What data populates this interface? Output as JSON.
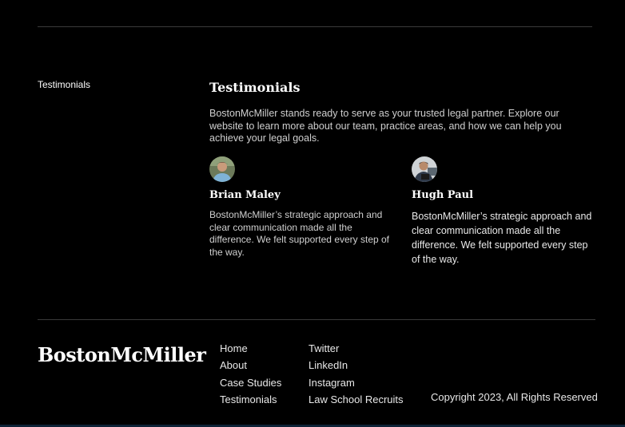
{
  "sidebar": {
    "label": "Testimonials"
  },
  "section": {
    "title": "Testimonials",
    "intro": "BostonMcMiller stands ready to serve as your trusted legal partner. Explore our website to learn more about our team, practice areas, and how we can help you achieve your legal goals."
  },
  "testimonials": [
    {
      "name": "Brian Maley",
      "quote": "BostonMcMiller’s strategic approach and clear communication made all the difference. We felt supported every step of the way."
    },
    {
      "name": "Hugh Paul",
      "quote": "BostonMcMiller’s strategic approach and clear communication made all the difference. We felt supported every step of the way."
    }
  ],
  "footer": {
    "brand": "BostonMcMiller",
    "nav": [
      "Home",
      "About",
      "Case Studies",
      "Testimonials"
    ],
    "social": [
      "Twitter",
      "LinkedIn",
      "Instagram",
      "Law School Recruits"
    ],
    "copyright": "Copyright 2023, All Rights Reserved"
  },
  "colors": {
    "background": "#000000",
    "text": "#ffffff",
    "muted": "#cfcfcf",
    "rule": "#3a3a3a"
  }
}
